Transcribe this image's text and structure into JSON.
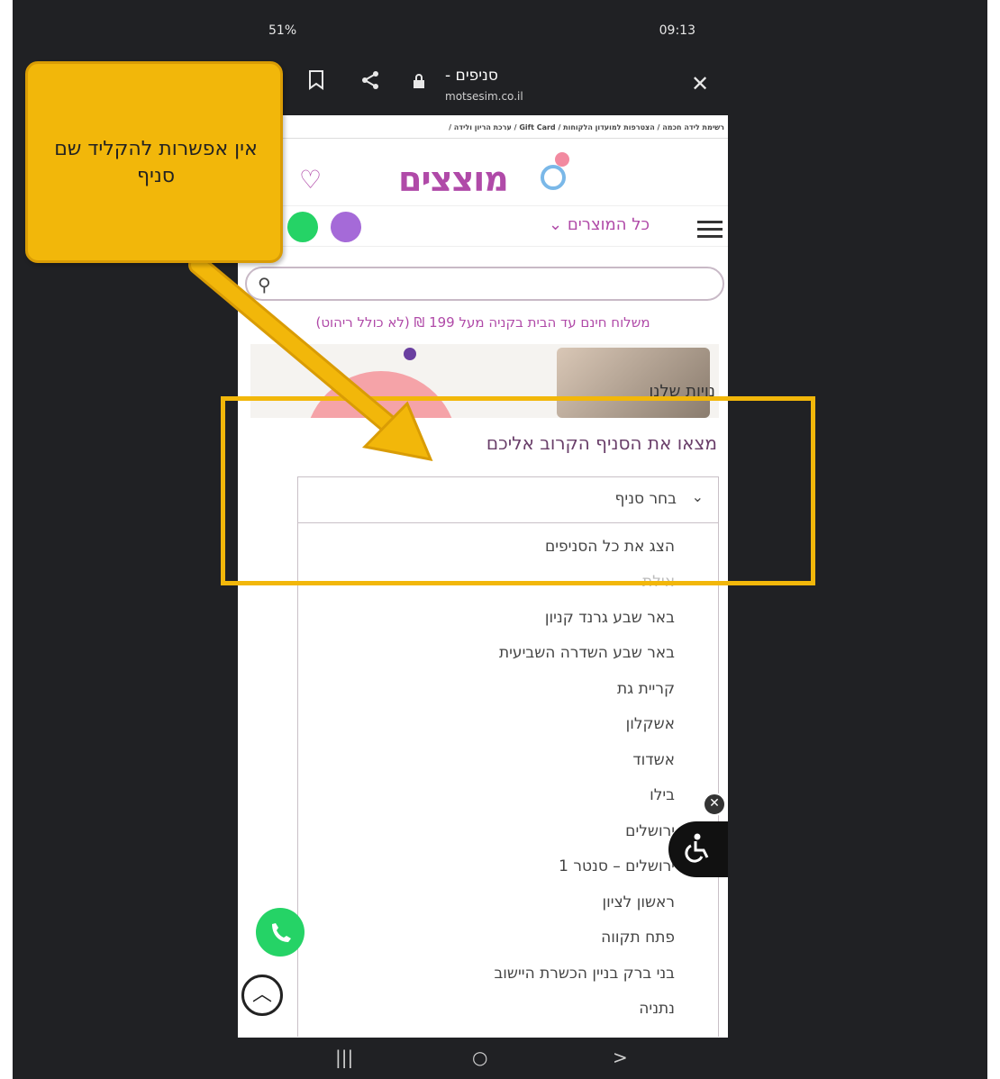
{
  "status_bar": {
    "battery": "51%",
    "time": "09:13"
  },
  "browser": {
    "page_title": "סניפים -",
    "domain": "motsesim.co.il",
    "bookmark_icon": "bookmark-icon",
    "share_icon": "share-icon",
    "lock_icon": "lock-icon",
    "close_icon": "close-icon"
  },
  "site": {
    "breadcrumbs": "רשימת לידה חכמה / הצטרפות למועדון הלקוחות / Gift Card / ערכת הריון ולידה /",
    "logo": "מוצצים",
    "menu_label": "כל המוצרים",
    "shipping_notice": "משלוח חינם עד הבית בקניה מעל 199 ₪ (לא כולל ריהוט)",
    "banner_text": "נויות שלנו",
    "find_branch_title": "מצאו את הסניף הקרוב אליכם",
    "select_value": "בחר סניף",
    "branch_options": [
      "הצג את כל הסניפים",
      "אילת",
      "באר שבע גרנד קניון",
      "באר שבע השדרה השביעית",
      "קריית גת",
      "אשקלון",
      "אשדוד",
      "בילו",
      "ירושלים",
      "ירושלים – סנטר 1",
      "ראשון לציון",
      "פתח תקווה",
      "בני ברק בניין הכשרת היישוב",
      "נתניה"
    ]
  },
  "annotation": {
    "callout_text": "אין אפשרות להקליד שם סניף",
    "highlight_color": "#f2b70a"
  },
  "nav_bar": {
    "recent": "|||",
    "home": "○",
    "back": ">"
  },
  "colors": {
    "brand": "#b04aa8",
    "whatsapp": "#25d366",
    "viber": "#a56ad8"
  }
}
